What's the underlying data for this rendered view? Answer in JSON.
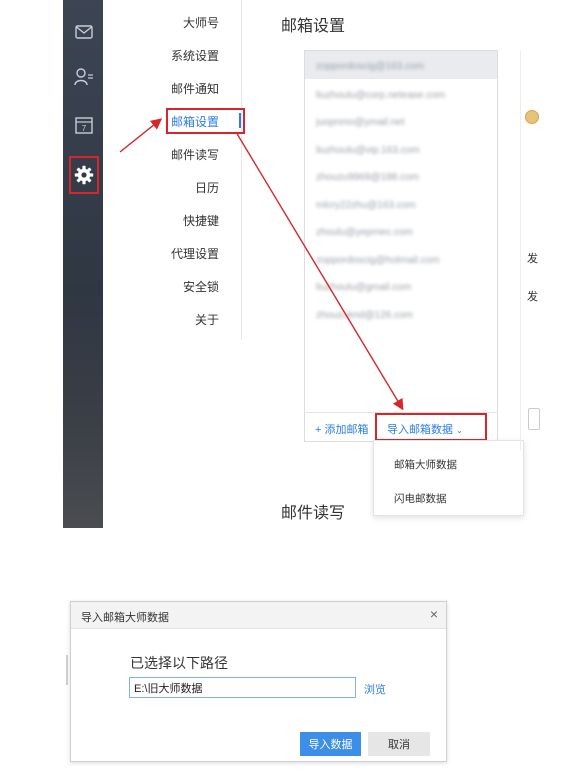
{
  "settings_page": {
    "section_title": "邮箱设置",
    "next_section_title": "邮件读写",
    "menu": {
      "items": [
        {
          "label": "大师号",
          "active": false
        },
        {
          "label": "系统设置",
          "active": false
        },
        {
          "label": "邮件通知",
          "active": false
        },
        {
          "label": "邮箱设置",
          "active": true
        },
        {
          "label": "邮件读写",
          "active": false
        },
        {
          "label": "日历",
          "active": false
        },
        {
          "label": "快捷键",
          "active": false
        },
        {
          "label": "代理设置",
          "active": false
        },
        {
          "label": "安全锁",
          "active": false
        },
        {
          "label": "关于",
          "active": false
        }
      ]
    },
    "sidebar_icons": [
      "mail-icon",
      "contacts-icon",
      "calendar-icon",
      "gear-icon"
    ],
    "calendar_day": "7",
    "accounts": [
      "zoppordoscig@163.com",
      "liuzhoulu@corp.netease.com",
      "juopnmo@ymail.net",
      "liuzhoulu@vip.163.com",
      "zhouzu9969@188.com",
      "mlcry22zhu@163.com",
      "zhoulu@yeprnec.com",
      "zoppordoscig@hotmail.com",
      "liuzhoulu@gmail.com",
      "zhouzuknd@126.com"
    ],
    "add_mailbox_label": "+ 添加邮箱",
    "import_button_label": "导入邮箱数据",
    "import_menu": [
      "邮箱大师数据",
      "闪电邮数据"
    ],
    "right_labels": [
      "发",
      "发"
    ]
  },
  "dialog": {
    "title": "导入邮箱大师数据",
    "close_label": "×",
    "prompt": "已选择以下路径",
    "path_value": "E:\\旧大师数据",
    "browse_label": "浏览",
    "import_label": "导入数据",
    "cancel_label": "取消"
  },
  "colors": {
    "accent": "#2b7de9",
    "highlight_red": "#d6262b",
    "sidebar_dark": "#333b47",
    "primary_button": "#3d8ee6"
  }
}
